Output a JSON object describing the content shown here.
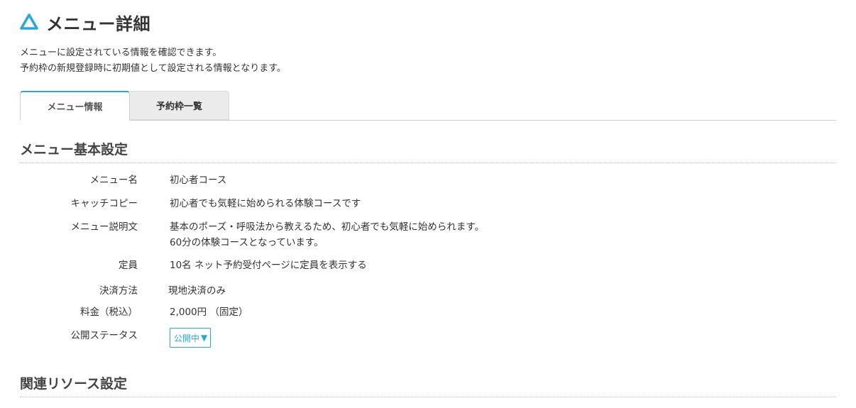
{
  "header": {
    "title": "メニュー詳細",
    "icon": "triangle-logo-icon",
    "accent": "#29a8d8"
  },
  "description": {
    "line1": "メニューに設定されている情報を確認できます。",
    "line2": "予約枠の新規登録時に初期値として設定される情報となります。"
  },
  "tabs": [
    {
      "label": "メニュー情報",
      "active": true
    },
    {
      "label": "予約枠一覧",
      "active": false
    }
  ],
  "sections": {
    "basic": {
      "title": "メニュー基本設定",
      "rows": {
        "menu_name": {
          "label": "メニュー名",
          "value": "初心者コース"
        },
        "catch_copy": {
          "label": "キャッチコピー",
          "value": "初心者でも気軽に始められる体験コースです"
        },
        "description": {
          "label": "メニュー説明文",
          "value_line1": "基本のポーズ・呼吸法から教えるため、初心者でも気軽に始められます。",
          "value_line2": "60分の体験コースとなっています。"
        },
        "capacity": {
          "label": "定員",
          "value": "10名 ネット予約受付ページに定員を表示する"
        },
        "payment": {
          "label": "決済方法",
          "value": "現地決済のみ"
        },
        "price": {
          "label": "料金（税込）",
          "value": "2,000円 （固定）"
        },
        "status": {
          "label": "公開ステータス",
          "value": "公開中",
          "caret": "▼"
        }
      }
    },
    "resources": {
      "title": "関連リソース設定"
    }
  }
}
